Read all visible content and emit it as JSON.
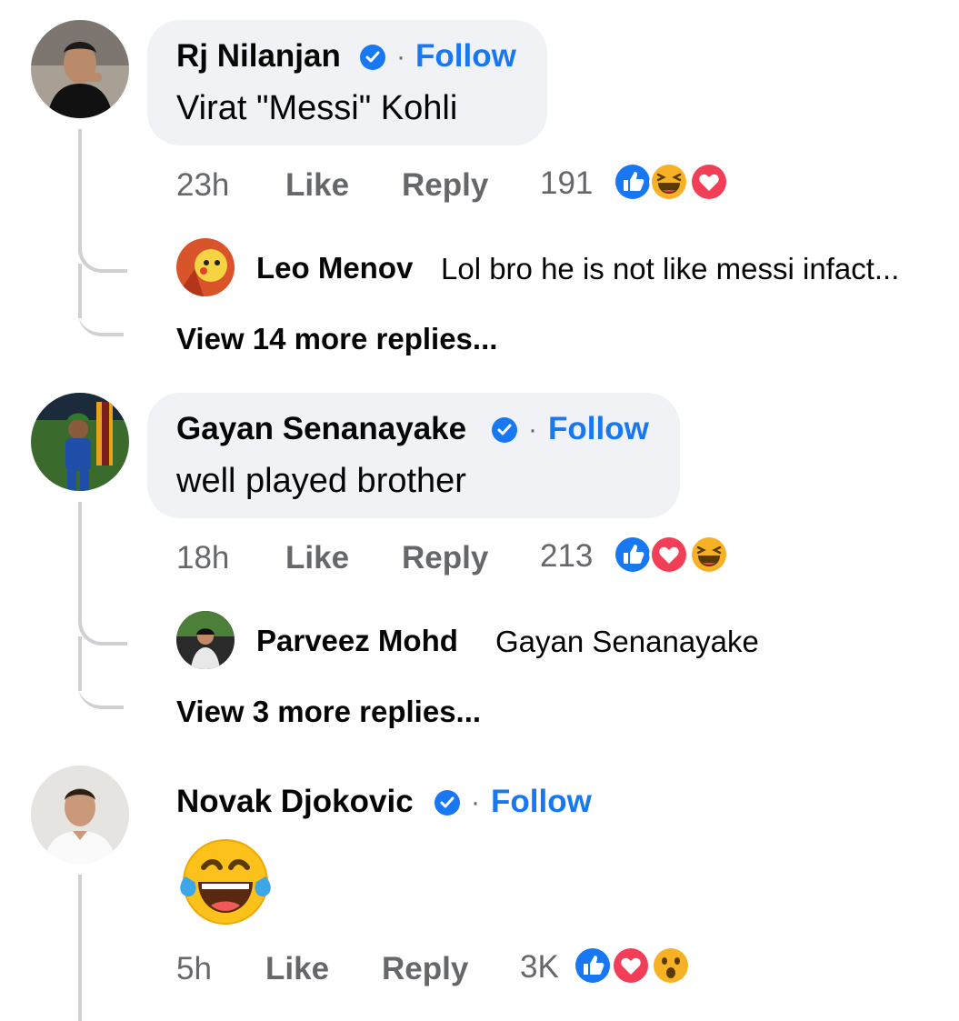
{
  "comments": [
    {
      "author": "Rj Nilanjan",
      "separator": "·",
      "follow_label": "Follow",
      "text": "Virat \"Messi\" Kohli",
      "time": "23h",
      "like_label": "Like",
      "reply_label": "Reply",
      "reaction_count": "191",
      "reactions": [
        "like",
        "haha",
        "love"
      ],
      "reply_preview": {
        "author": "Leo Menov",
        "text": "Lol bro he is not like messi infact..."
      },
      "more_replies": "View 14 more replies..."
    },
    {
      "author": "Gayan Senanayake",
      "separator": "·",
      "follow_label": "Follow",
      "text": "well played brother",
      "time": "18h",
      "like_label": "Like",
      "reply_label": "Reply",
      "reaction_count": "213",
      "reactions": [
        "like",
        "love",
        "haha"
      ],
      "reply_preview": {
        "author": "Parveez Mohd",
        "text": "Gayan Senanayake"
      },
      "more_replies": "View 3 more replies..."
    },
    {
      "author": "Novak Djokovic",
      "separator": "·",
      "follow_label": "Follow",
      "emoji": "laughing-with-tears",
      "time": "5h",
      "like_label": "Like",
      "reply_label": "Reply",
      "reaction_count": "3K",
      "reactions": [
        "like",
        "love",
        "wow"
      ]
    }
  ],
  "colors": {
    "bubble": "#f0f2f5",
    "link": "#1877f2",
    "meta": "#65676b",
    "like": "#1877f2",
    "love": "#f33e58",
    "haha": "#f7b125"
  }
}
